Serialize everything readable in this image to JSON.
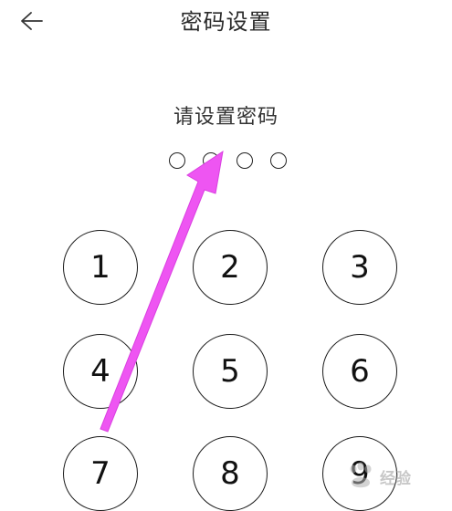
{
  "header": {
    "title": "密码设置",
    "back_icon": "arrow-left-icon"
  },
  "prompt": "请设置密码",
  "pin": {
    "length": 4,
    "entered": 0
  },
  "keypad": {
    "keys": [
      "1",
      "2",
      "3",
      "4",
      "5",
      "6",
      "7",
      "8",
      "9"
    ]
  },
  "annotation": {
    "color": "#ee55f2"
  },
  "watermark": {
    "text": "经验"
  }
}
